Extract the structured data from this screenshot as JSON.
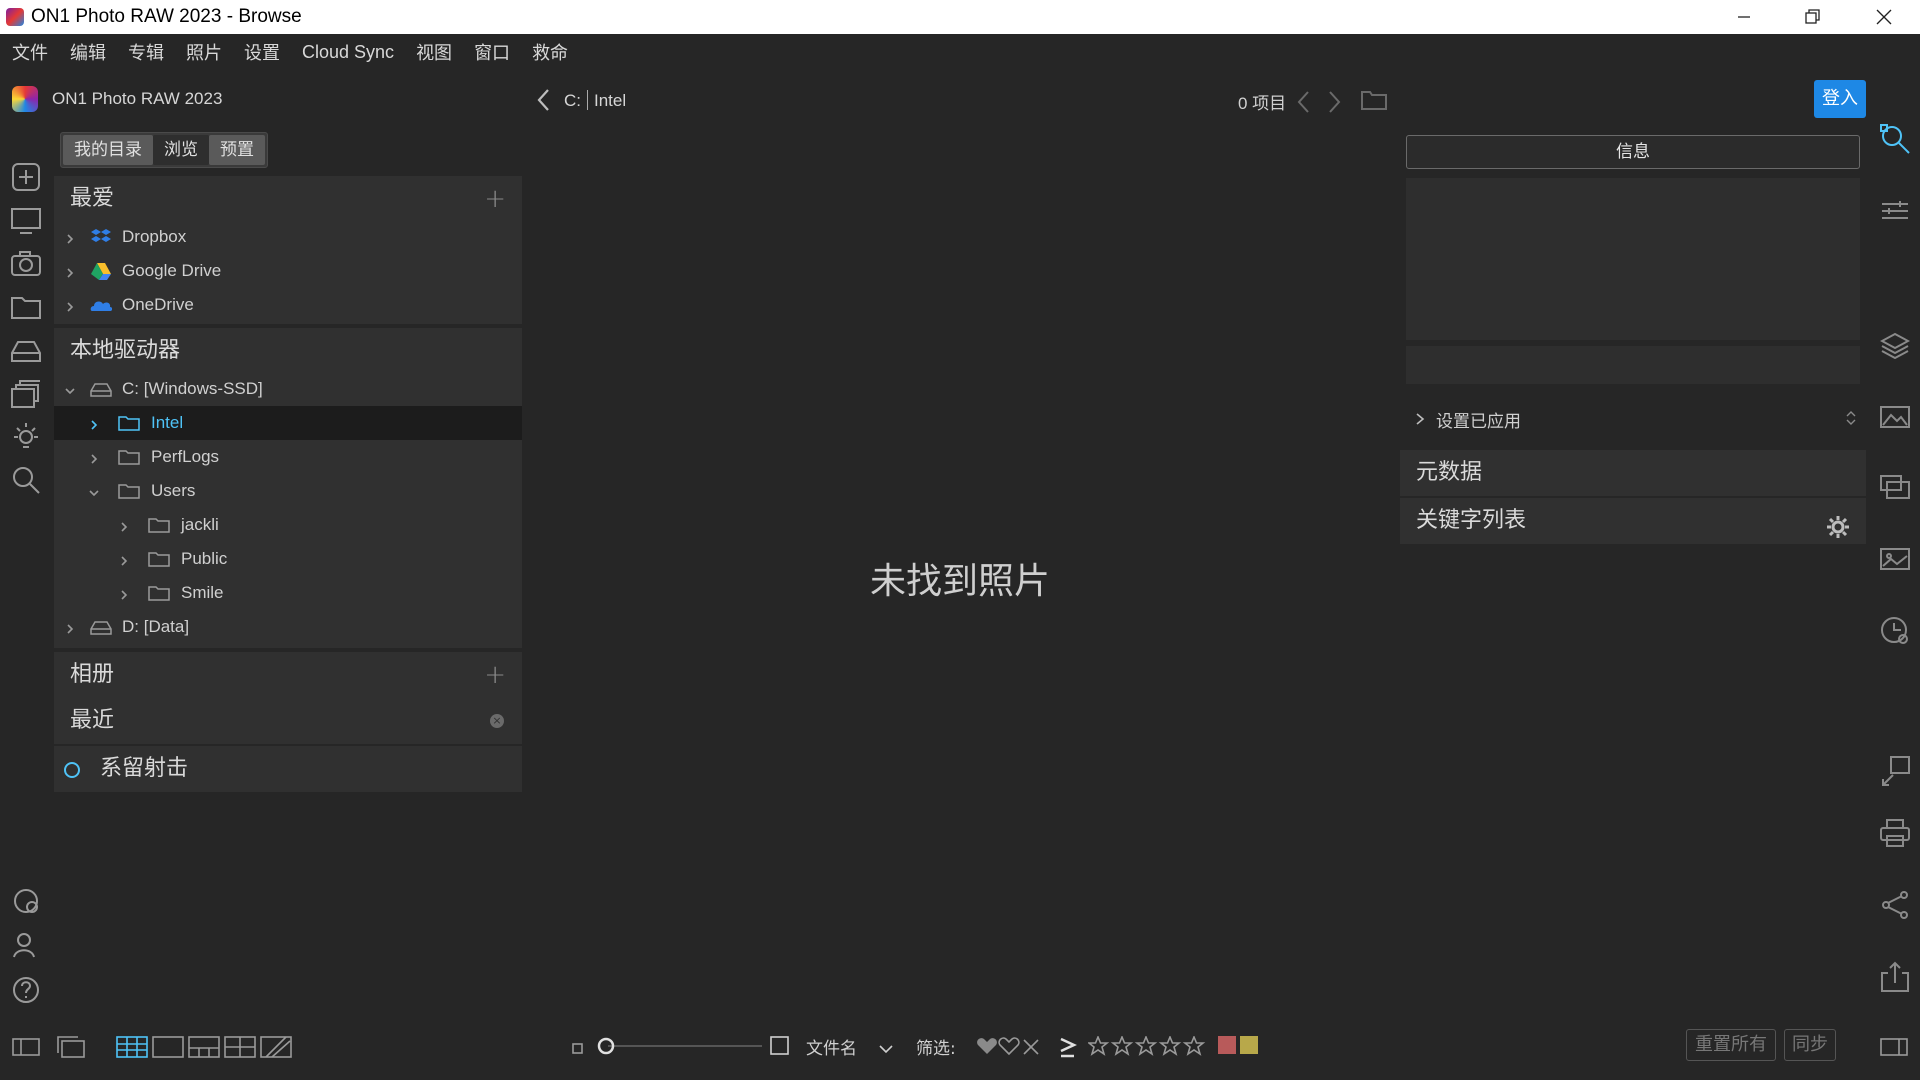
{
  "window": {
    "title": "ON1 Photo RAW 2023 - Browse"
  },
  "menu": [
    "文件",
    "编辑",
    "专辑",
    "照片",
    "设置",
    "Cloud Sync",
    "视图",
    "窗口",
    "救命"
  ],
  "app": {
    "name": "ON1 Photo RAW 2023"
  },
  "browser_tabs": [
    "我的目录",
    "浏览",
    "预置"
  ],
  "favorites": {
    "title": "最爱",
    "items": [
      "Dropbox",
      "Google Drive",
      "OneDrive"
    ]
  },
  "local_drives": {
    "title": "本地驱动器",
    "items": [
      {
        "label": "C: [Windows-SSD]"
      },
      {
        "label": "Intel"
      },
      {
        "label": "PerfLogs"
      },
      {
        "label": "Users"
      },
      {
        "label": "jackli"
      },
      {
        "label": "Public"
      },
      {
        "label": "Smile"
      },
      {
        "label": "D: [Data]"
      }
    ]
  },
  "albums": {
    "title": "相册"
  },
  "recent": {
    "title": "最近"
  },
  "tethered": {
    "label": "系留射击"
  },
  "breadcrumb": {
    "drive": "C:",
    "folder": "Intel"
  },
  "item_count": "0 项目",
  "empty_message": "未找到照片",
  "right_panel": {
    "login": "登入",
    "info_tab": "信息",
    "settings_applied": "设置已应用",
    "metadata": "元数据",
    "keyword_list": "关键字列表"
  },
  "bottom": {
    "sort_field": "文件名",
    "filter_label": "筛选:",
    "reset_all": "重置所有",
    "sync": "同步"
  },
  "colors": {
    "accent": "#1e88e5",
    "selected_text": "#4fc3f7",
    "background": "#262626",
    "panel": "#303030"
  }
}
